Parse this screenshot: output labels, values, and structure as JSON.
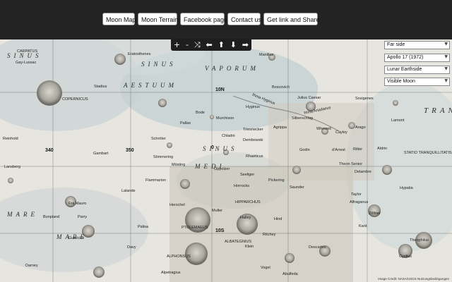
{
  "nav": {
    "moon_map": "Moon Map",
    "moon_terrain": "Moon Terrain",
    "facebook": "Facebook page",
    "contact": "Contact us",
    "share": "Get link and Share"
  },
  "controls": {
    "zoom_in": "+",
    "zoom_out": "-",
    "random": "⤨",
    "left": "⬅",
    "up": "⬆",
    "down": "⬇",
    "right": "➡"
  },
  "selects": {
    "side": "Far side",
    "mission": "Apollo 17 (1972)",
    "view": "Lunar Earthside",
    "layer": "Visible Moon"
  },
  "regions": {
    "aestuum_1": "SINUS",
    "aestuum_2": "AESTUUM",
    "vaporum": "VAPORUM",
    "medii_1": "SINUS",
    "medii_2": "MEDI",
    "mare_1": "MARE",
    "mare_2": "MARE",
    "tran": "TRAN"
  },
  "labels": {
    "carpatus": "CARPATUS",
    "gaylussac": "Gay-Lussac",
    "eratosthenes": "Eratosthenes",
    "copernicus": "COPERNICUS",
    "stadius": "Stadius",
    "manilius": "Manilius",
    "boscovich": "Boscovich",
    "julius_caesar": "Julius Caesar",
    "rima_hyginus": "Rima Hyginus",
    "rima_ariadaeus": "Rima Ariadaeus",
    "sosigenes": "Sosigenes",
    "hyginus": "Hyginus",
    "silberschlag": "Silberschlag",
    "bode": "Bode",
    "pallas": "Pallas",
    "murchison": "Murchison",
    "chladni": "Chladni",
    "triesnecker": "Triesnecker",
    "agrippa": "Agrippa",
    "whewell": "Whewell",
    "cayley": "Cayley",
    "arago": "Arago",
    "lamont": "Lamont",
    "dembowski": "Dembowski",
    "reinhold": "Reinhold",
    "schroter": "Schröter",
    "rhaeticus": "Rhaeticus",
    "godin": "Godin",
    "darrest": "d'Arrest",
    "ritter": "Ritter",
    "aldrin": "Aldrin",
    "gambart": "Gambart",
    "sommering": "Sömmering",
    "statio": "STATIO TRANQUILLITATIS",
    "lansberg": "Lansberg",
    "mosting": "Mösting",
    "oppolzer": "Oppolzer",
    "theon_senior": "Theon Senior",
    "delambre": "Delambre",
    "flammarion": "Flammarion",
    "seeliger": "Seeliger",
    "pickering": "Pickering",
    "saunder": "Saunder",
    "taylor": "Taylor",
    "hypatia": "Hypatia",
    "lalande": "Lalande",
    "herschel": "Herschel",
    "horrocks": "Horrocks",
    "hipparchus": "HIPPARCHUS",
    "alfraganus": "Alfraganus",
    "fra_mauro": "Fra Mauro",
    "bonpland": "Bonpland",
    "parry": "Parry",
    "muller": "Muller",
    "halley": "Halley",
    "hind": "Hind",
    "zollner": "Zöllner",
    "palisa": "Palisa",
    "ptolemaeus": "PTOLEMAEUS",
    "kant": "Kant",
    "guericke": "Guericke",
    "davy": "Davy",
    "ritchey": "Ritchey",
    "albategnius": "ALBATEGNIUS",
    "alphonsus": "ALPHONSUS",
    "klein": "Klein",
    "descartes": "Descartes",
    "theophilus": "Theophilus",
    "darney": "Darney",
    "alpetragius": "Alpetragius",
    "vogel": "Vogel",
    "abulfeda": "Abulfeda",
    "cyrillus": "Cyrillus"
  },
  "grid": {
    "n10": "10N",
    "d340": "340",
    "d350": "350",
    "d0": "0",
    "s10": "10S"
  },
  "credit": "Image Credit: NASA/USGS    Nutzungsbedingungen"
}
